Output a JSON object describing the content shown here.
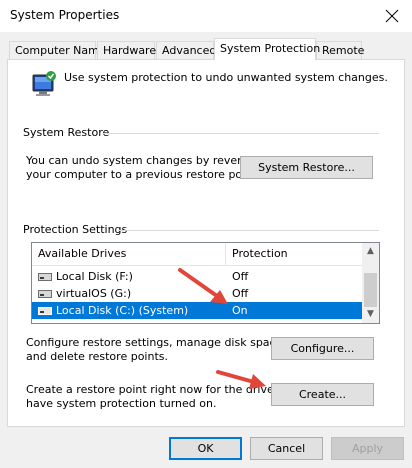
{
  "window": {
    "title": "System Properties",
    "close_icon": "close-icon"
  },
  "tabs": [
    {
      "label": "Computer Name"
    },
    {
      "label": "Hardware"
    },
    {
      "label": "Advanced"
    },
    {
      "label": "System Protection",
      "active": true
    },
    {
      "label": "Remote"
    }
  ],
  "intro": {
    "text": "Use system protection to undo unwanted system changes.",
    "icon": "system-protection-icon"
  },
  "system_restore": {
    "group_title": "System Restore",
    "description_line1": "You can undo system changes by reverting",
    "description_line2": "your computer to a previous restore point.",
    "button_label": "System Restore..."
  },
  "protection_settings": {
    "group_title": "Protection Settings",
    "columns": [
      "Available Drives",
      "Protection"
    ],
    "drives": [
      {
        "name": "Local Disk (F:)",
        "protection": "Off",
        "selected": false
      },
      {
        "name": "virtualOS (G:)",
        "protection": "Off",
        "selected": false
      },
      {
        "name": "Local Disk (C:) (System)",
        "protection": "On",
        "selected": true
      }
    ],
    "configure_text_line1": "Configure restore settings, manage disk space,",
    "configure_text_line2": "and delete restore points.",
    "configure_button": "Configure...",
    "create_text_line1": "Create a restore point right now for the drives that",
    "create_text_line2": "have system protection turned on.",
    "create_button": "Create..."
  },
  "footer": {
    "ok": "OK",
    "cancel": "Cancel",
    "apply": "Apply"
  },
  "colors": {
    "selection": "#0078d7",
    "annotation_arrow": "#e0463a"
  }
}
